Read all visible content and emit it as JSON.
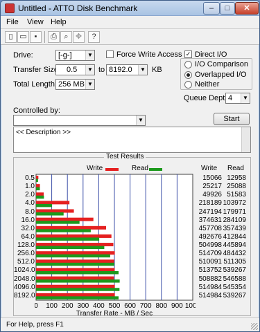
{
  "window": {
    "title": "Untitled - ATTO Disk Benchmark",
    "minimize": "–",
    "maximize": "□",
    "close": "✕"
  },
  "menu": [
    "File",
    "View",
    "Help"
  ],
  "toolbar": [
    "new-file-icon",
    "open-folder-icon",
    "save-icon",
    "print-icon",
    "print-preview-icon",
    "move-icon",
    "about-icon"
  ],
  "form": {
    "drive_label": "Drive:",
    "drive_value": "[-g-]",
    "transfer_size_label": "Transfer Size:",
    "transfer_from": "0.5",
    "to_label": "to",
    "transfer_to": "8192.0",
    "kb_label": "KB",
    "total_length_label": "Total Length:",
    "total_length_value": "256 MB",
    "force_write_label": "Force Write Access",
    "force_write_checked": false,
    "direct_io_label": "Direct I/O",
    "direct_io_checked": true,
    "io_options": [
      {
        "label": "I/O Comparison",
        "selected": false
      },
      {
        "label": "Overlapped I/O",
        "selected": true
      },
      {
        "label": "Neither",
        "selected": false
      }
    ],
    "queue_depth_label": "Queue Depth:",
    "queue_depth_value": "4",
    "controlled_by_label": "Controlled by:",
    "controlled_by_value": "",
    "start_button": "Start",
    "description": "<< Description >>"
  },
  "results": {
    "title": "Test Results",
    "write_label": "Write",
    "read_label": "Read",
    "write_color": "#e52020",
    "read_color": "#1c9a1c",
    "col_write": "Write",
    "col_read": "Read",
    "rows": [
      {
        "size": "0.5",
        "write": "15066",
        "read": "12958"
      },
      {
        "size": "1.0",
        "write": "25217",
        "read": "25088"
      },
      {
        "size": "2.0",
        "write": "49926",
        "read": "51583"
      },
      {
        "size": "4.0",
        "write": "218189",
        "read": "103972"
      },
      {
        "size": "8.0",
        "write": "247194",
        "read": "179971"
      },
      {
        "size": "16.0",
        "write": "374631",
        "read": "284109"
      },
      {
        "size": "32.0",
        "write": "457708",
        "read": "357439"
      },
      {
        "size": "64.0",
        "write": "492676",
        "read": "412844"
      },
      {
        "size": "128.0",
        "write": "504998",
        "read": "445894"
      },
      {
        "size": "256.0",
        "write": "514709",
        "read": "484432"
      },
      {
        "size": "512.0",
        "write": "510091",
        "read": "511305"
      },
      {
        "size": "1024.0",
        "write": "513752",
        "read": "539267"
      },
      {
        "size": "2048.0",
        "write": "508882",
        "read": "546588"
      },
      {
        "size": "4096.0",
        "write": "514984",
        "read": "545354"
      },
      {
        "size": "8192.0",
        "write": "514984",
        "read": "539267"
      }
    ]
  },
  "chart_data": {
    "type": "bar",
    "title": "Test Results",
    "xlabel": "Transfer Rate - MB / Sec",
    "ylabel": "",
    "xlim": [
      0,
      1000
    ],
    "xticks": [
      "0",
      "100",
      "200",
      "300",
      "400",
      "500",
      "600",
      "700",
      "800",
      "900",
      "1000"
    ],
    "categories": [
      "0.5",
      "1.0",
      "2.0",
      "4.0",
      "8.0",
      "16.0",
      "32.0",
      "64.0",
      "128.0",
      "256.0",
      "512.0",
      "1024.0",
      "2048.0",
      "4096.0",
      "8192.0"
    ],
    "series": [
      {
        "name": "Write",
        "color": "#e52020",
        "values": [
          14.7,
          24.6,
          48.8,
          213.1,
          241.4,
          365.9,
          447.0,
          481.1,
          493.2,
          502.6,
          498.1,
          501.7,
          497.0,
          502.9,
          502.9
        ]
      },
      {
        "name": "Read",
        "color": "#1c9a1c",
        "values": [
          12.7,
          24.5,
          50.4,
          101.5,
          175.8,
          277.4,
          349.1,
          403.2,
          435.4,
          473.1,
          499.3,
          526.6,
          533.8,
          532.6,
          526.6
        ]
      }
    ],
    "grid": true,
    "legend": "top"
  },
  "status": {
    "text": "For Help, press F1"
  }
}
